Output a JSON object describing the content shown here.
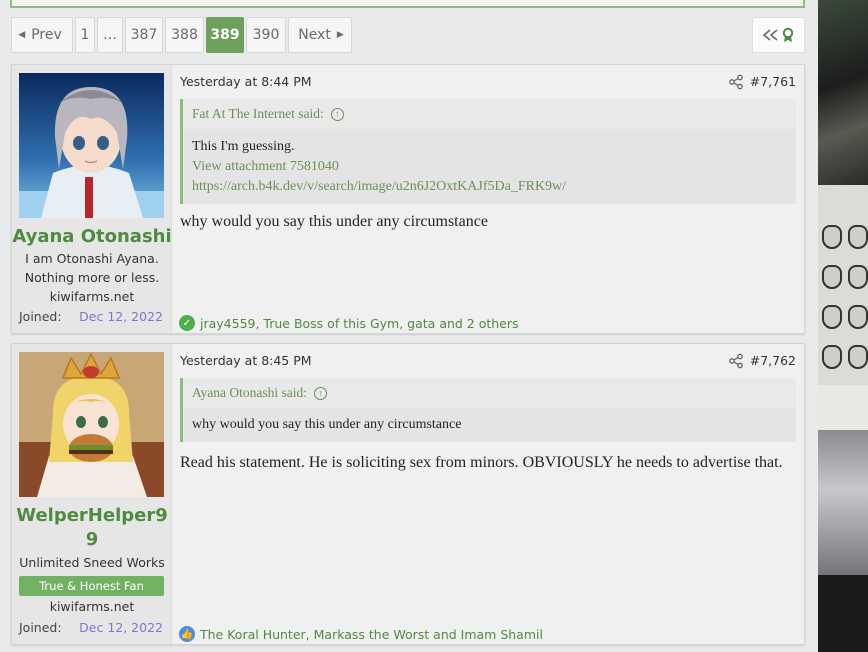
{
  "pagination": {
    "prev_label": "Prev",
    "pages": [
      "1",
      "…",
      "387",
      "388",
      "389",
      "390"
    ],
    "current": "389",
    "next_label": "Next"
  },
  "colors": {
    "accent": "#6da05a",
    "username": "#4f8a40",
    "joined_date": "#8a6fd0",
    "quote_border": "#8cbf7c"
  },
  "posts": [
    {
      "username": "Ayana Otonashi",
      "user_title": "I am Otonashi Ayana. Nothing more or less.",
      "user_title_lines": [
        "I am Otonashi Ayana.",
        "Nothing more or less."
      ],
      "site": "kiwifarms.net",
      "joined_label": "Joined:",
      "joined_date": "Dec 12, 2022",
      "date": "Yesterday at 8:44 PM",
      "post_number": "#7,761",
      "quote": {
        "author": "Fat At The Internet said:",
        "lines": [
          "This I'm guessing."
        ],
        "attachment": "View attachment 7581040",
        "link": "https://arch.b4k.dev/v/search/image/u2n6J2OxtKAJf5Da_FRK9w/"
      },
      "body": "why would you say this under any circumstance",
      "reaction_icon": "check-reaction-icon",
      "reactions": "jray4559, True Boss of this Gym, gata and 2 others"
    },
    {
      "username": "WelperHelper99",
      "username_lines": [
        "WelperHelper9",
        "9"
      ],
      "user_title": "Unlimited Sneed Works",
      "banner": "True & Honest Fan",
      "site": "kiwifarms.net",
      "joined_label": "Joined:",
      "joined_date": "Dec 12, 2022",
      "date": "Yesterday at 8:45 PM",
      "post_number": "#7,762",
      "quote": {
        "author": "Ayana Otonashi said:",
        "lines": [
          "why would you say this under any circumstance"
        ]
      },
      "body": "Read his statement. He is soliciting sex from minors. OBVIOUSLY he needs to advertise that.",
      "reaction_icon": "like-reaction-icon",
      "reactions": "The Koral Hunter, Markass the Worst and Imam Shamil"
    }
  ]
}
